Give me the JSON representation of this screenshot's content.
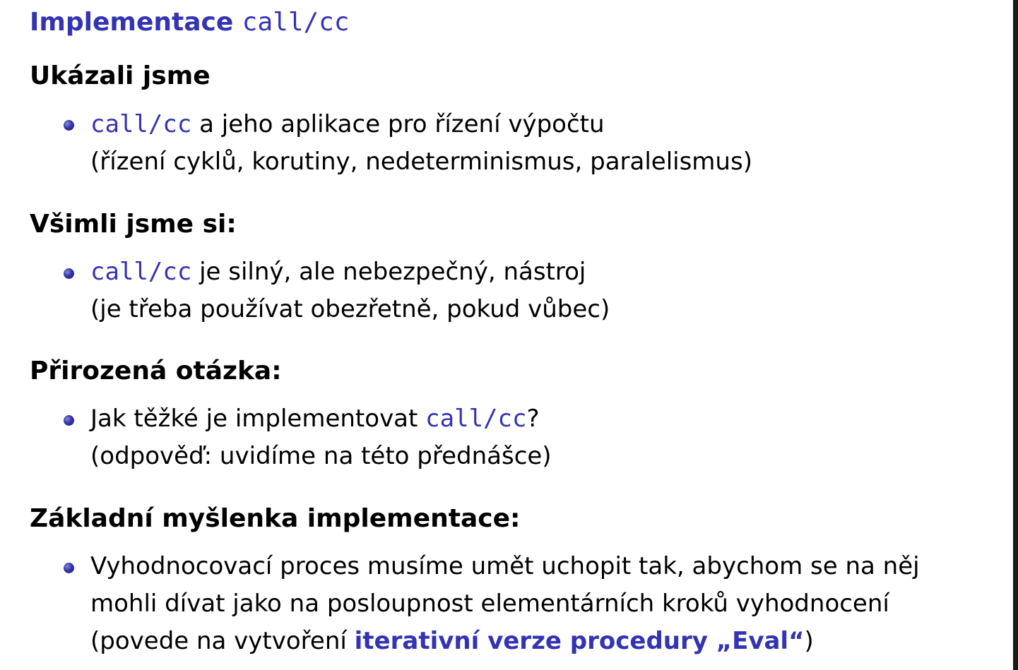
{
  "title": {
    "text": "Implementace",
    "code": "call/cc"
  },
  "sections": [
    {
      "heading": "Ukázali jsme",
      "bullet_code": "call/cc",
      "bullet_text": " a jeho aplikace pro řízení výpočtu",
      "bullet_line2": "(řízení cyklů, korutiny, nedeterminismus, paralelismus)"
    },
    {
      "heading": "Všimli jsme si:",
      "bullet_code": "call/cc",
      "bullet_text": " je silný, ale nebezpečný, nástroj",
      "bullet_line2": "(je třeba používat obezřetně, pokud vůbec)"
    },
    {
      "heading": "Přirozená otázka:",
      "bullet_text": "Jak těžké je implementovat ",
      "bullet_code": "call/cc",
      "bullet_suffix": "?",
      "bullet_line2": "(odpověď: uvidíme na této přednášce)"
    },
    {
      "heading": "Základní myšlenka implementace:",
      "bullet_text": "Vyhodnocovací proces musíme umět uchopit tak, abychom se na něj",
      "bullet_line2": "mohli dívat jako na posloupnost elementárních kroků vyhodnocení",
      "bullet_line3_prefix": "(povede na vytvoření ",
      "bullet_line3_emph": "iterativní verze procedury „Eval“",
      "bullet_line3_suffix": ")"
    }
  ],
  "colors": {
    "accent": "#3333b3",
    "text": "#000000",
    "background": "#ffffff"
  }
}
